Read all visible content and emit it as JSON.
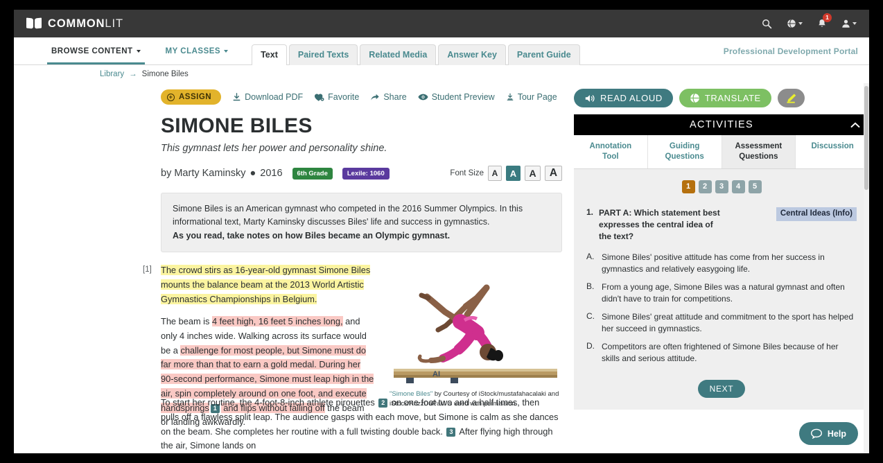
{
  "header": {
    "brand_bold": "COMMON",
    "brand_light": "LIT",
    "icons": {
      "search": "search-icon",
      "globe": "globe-icon",
      "bell": "bell-icon",
      "bell_badge": "1",
      "account": "account-icon"
    }
  },
  "nav": {
    "browse_content": "BROWSE CONTENT",
    "my_classes": "MY CLASSES",
    "tabs": [
      {
        "label": "Text",
        "active": true
      },
      {
        "label": "Paired Texts",
        "active": false
      },
      {
        "label": "Related Media",
        "active": false
      },
      {
        "label": "Answer Key",
        "active": false
      },
      {
        "label": "Parent Guide",
        "active": false
      }
    ],
    "pd_portal": "Professional Development Portal"
  },
  "breadcrumb": {
    "library": "Library",
    "arrow": "→",
    "current": "Simone Biles"
  },
  "actions": {
    "assign": "ASSIGN",
    "download_pdf": "Download PDF",
    "favorite": "Favorite",
    "share": "Share",
    "student_preview": "Student Preview",
    "tour_page": "Tour Page"
  },
  "article": {
    "title": "SIMONE BILES",
    "subtitle": "This gymnast lets her power and personality shine.",
    "byline": "by Marty Kaminsky",
    "dot": "●",
    "year": "2016",
    "grade_pill": "6th Grade",
    "lexile_pill": "Lexile: 1060",
    "font_size_label": "Font Size",
    "font_size_options": [
      "A",
      "A",
      "A",
      "A"
    ],
    "font_size_selected_index": 1,
    "summary_line1": "Simone Biles is an American gymnast who competed in the 2016 Summer Olympics. In this informational text, Marty Kaminsky discusses Biles' life and success in gymnastics.",
    "summary_bold": "As you read, take notes on how Biles became an Olympic gymnast.",
    "paragraph_number": "[1]",
    "p1_highlight": "The crowd stirs as 16-year-old gymnast Simone Biles mounts the balance beam at the 2013 World Artistic Gymnastics Championships in Belgium.",
    "p2_a": "The beam is ",
    "p2_hl1": "4 feet high, 16 feet 5 inches long,",
    "p2_b": " and only 4 inches wide. Walking across its surface would be a ",
    "p2_hl2": "challenge for most people, but Simone must do far more than that to earn a gold medal. During her 90-second performance, Simone must leap high in the air, spin completely around on one foot, and execute handsprings",
    "fn1": "1",
    "p2_hl3": " and flips without falling off",
    "p2_c": " the beam or landing awkwardly.",
    "p3_a": "To start her routine, the 4-foot-8-inch athlete pirouettes",
    "fn2": "2",
    "p3_b": "on one foot two and a half times, then pulls off a flawless split leap. The audience gasps with each move, but Simone is calm as she dances on the beam. She completes her routine with a full twisting double back.",
    "fn3": "3",
    "p3_c": "After flying high through the air, Simone lands on",
    "caption_quote": "\"Simone Biles\"",
    "caption_rest": " by Courtesy of iStock/mustafahacalaki and iStock/KrizzDaPaul is used with permission."
  },
  "right_panel": {
    "read_aloud": "READ ALOUD",
    "translate": "TRANSLATE",
    "highlighter": "highlighter-pen-icon",
    "activities_title": "ACTIVITIES",
    "collapse_chevron": "⌃",
    "tabs": [
      {
        "label_line1": "Annotation",
        "label_line2": "Tool",
        "active": false
      },
      {
        "label_line1": "Guiding",
        "label_line2": "Questions",
        "active": false
      },
      {
        "label_line1": "Assessment",
        "label_line2": "Questions",
        "active": true
      },
      {
        "label_line1": "Discussion",
        "label_line2": "",
        "active": false
      }
    ],
    "question_numbers": [
      "1",
      "2",
      "3",
      "4",
      "5"
    ],
    "active_question": "1",
    "question": {
      "number": "1.",
      "prompt": "PART A: Which statement best expresses the central idea of the text?",
      "tag": "Central Ideas (Info)",
      "choices": [
        {
          "letter": "A.",
          "text": "Simone Biles' positive attitude has come from her success in gymnastics and relatively easygoing life."
        },
        {
          "letter": "B.",
          "text": "From a young age, Simone Biles was a natural gymnast and often didn't have to train for competitions."
        },
        {
          "letter": "C.",
          "text": "Simone Biles' great attitude and commitment to the sport has helped her succeed in gymnastics."
        },
        {
          "letter": "D.",
          "text": "Competitors are often frightened of Simone Biles because of her skills and serious attitude."
        }
      ]
    },
    "next_button": "NEXT",
    "help_button": "Help"
  },
  "colors": {
    "teal": "#3f7a80",
    "teal_link": "#4a8a8f",
    "topbar": "#383838",
    "assign_yellow": "#e2b32b",
    "grade_green": "#2e8540",
    "lexile_purple": "#5a3a9e",
    "translate_green": "#7dc063",
    "active_qnum": "#b5700e",
    "tag_blue": "#bcc9e0",
    "highlight_yellow": "#fbf4a0",
    "highlight_pink": "#fac9c4",
    "badge_red": "#d0392b"
  }
}
